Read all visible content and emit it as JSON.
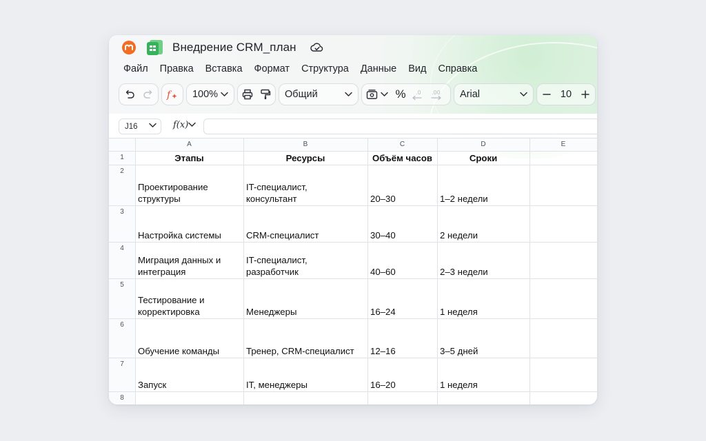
{
  "document": {
    "title": "Внедрение CRM_план"
  },
  "menu": [
    "Файл",
    "Правка",
    "Вставка",
    "Формат",
    "Структура",
    "Данные",
    "Вид",
    "Справка"
  ],
  "toolbar": {
    "zoom": "100%",
    "number_format": "Общий",
    "percent_label": "%",
    "font_name": "Arial",
    "font_size": "10"
  },
  "formula_bar": {
    "cell_ref": "J16",
    "fx_label": "f(x)",
    "value": ""
  },
  "columns": [
    "A",
    "B",
    "C",
    "D",
    "E"
  ],
  "rows": [
    "1",
    "2",
    "3",
    "4",
    "5",
    "6",
    "7",
    "8"
  ],
  "table": {
    "headers": [
      "Этапы",
      "Ресурсы",
      "Объём часов",
      "Сроки"
    ],
    "data": [
      {
        "stage": [
          "Проектирование",
          "структуры"
        ],
        "resources": [
          "IT-специалист,",
          "консультант"
        ],
        "hours": "20–30",
        "term": "1–2 недели"
      },
      {
        "stage": [
          "Настройка системы"
        ],
        "resources": [
          "CRM-специалист"
        ],
        "hours": "30–40",
        "term": "2 недели"
      },
      {
        "stage": [
          "Миграция данных и",
          "интеграция"
        ],
        "resources": [
          "IT-специалист,",
          "разработчик"
        ],
        "hours": "40–60",
        "term": "2–3 недели"
      },
      {
        "stage": [
          "Тестирование и",
          "корректировка"
        ],
        "resources": [
          "Менеджеры"
        ],
        "hours": "16–24",
        "term": "1 неделя"
      },
      {
        "stage": [
          "Обучение команды"
        ],
        "resources": [
          "Тренер, CRM-специалист"
        ],
        "hours": "12–16",
        "term": "3–5 дней"
      },
      {
        "stage": [
          "Запуск"
        ],
        "resources": [
          "IT, менеджеры"
        ],
        "hours": "16–20",
        "term": "1 неделя"
      }
    ]
  },
  "colors": {
    "accent_green": "#2fa84f",
    "sheet_logo": "#36b25a",
    "orange_logo": "#f26d21",
    "formula_red": "#e0513b"
  }
}
